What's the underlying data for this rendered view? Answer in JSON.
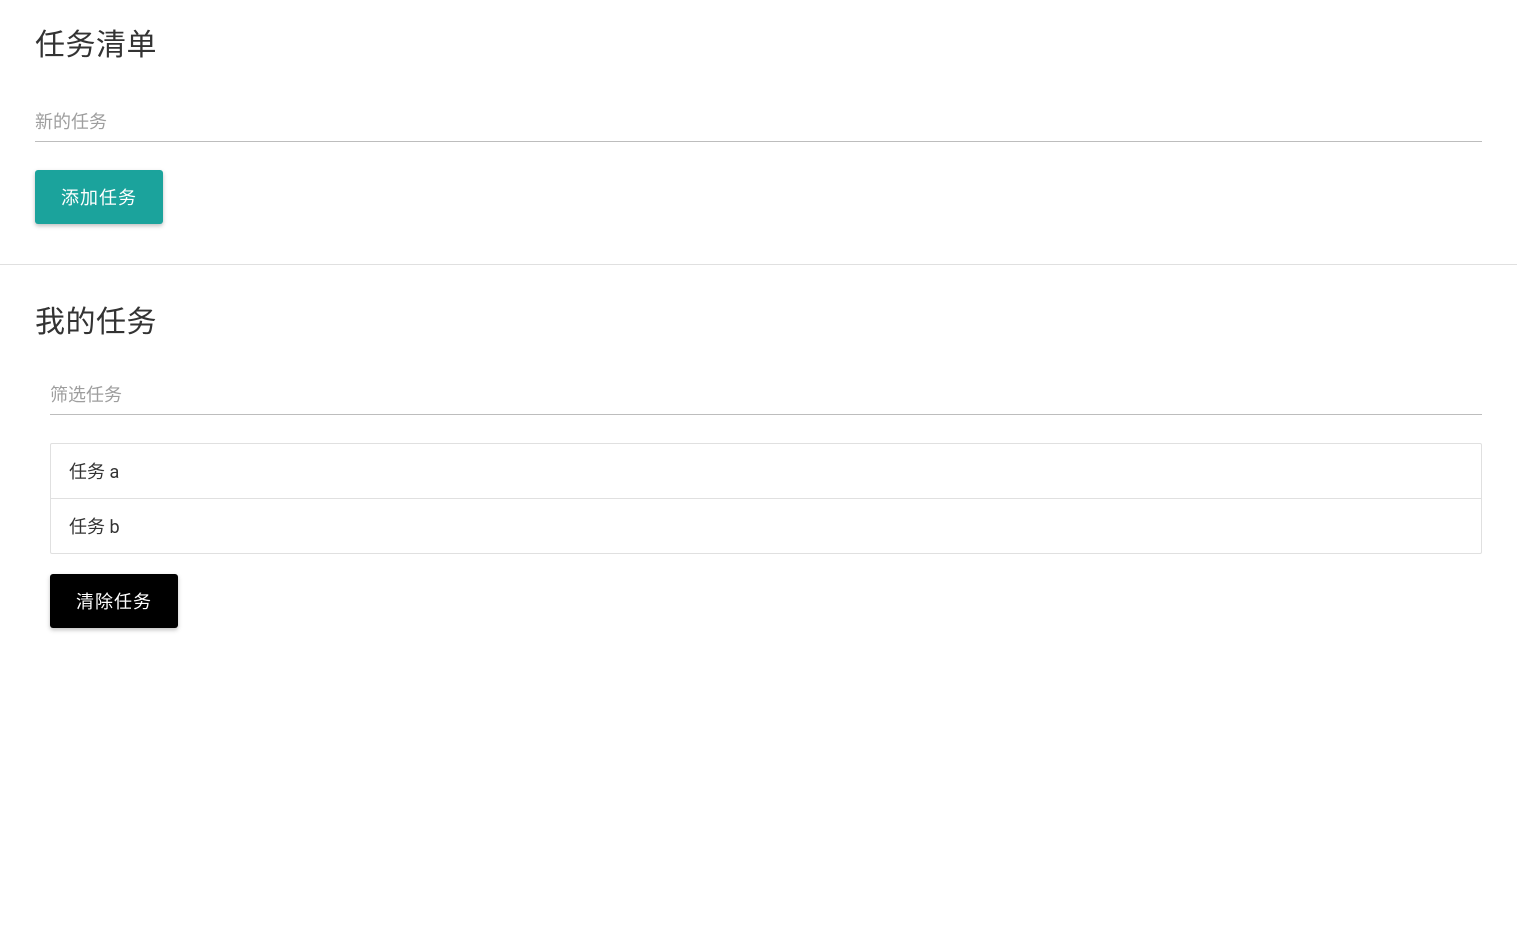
{
  "top": {
    "title": "任务清单",
    "new_task_placeholder": "新的任务",
    "add_button_label": "添加任务"
  },
  "bottom": {
    "title": "我的任务",
    "filter_placeholder": "筛选任务",
    "tasks": [
      "任务 a",
      "任务 b"
    ],
    "clear_button_label": "清除任务"
  },
  "colors": {
    "accent": "#1ba39c",
    "black": "#000000"
  }
}
